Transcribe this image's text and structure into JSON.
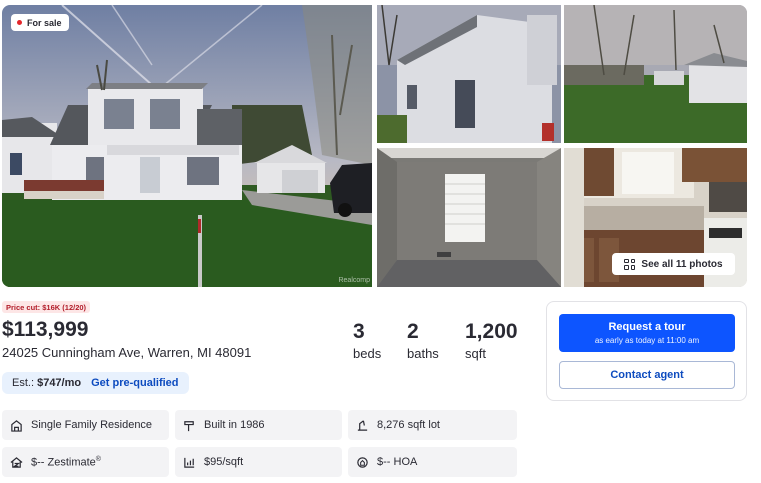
{
  "gallery": {
    "status_badge": "For sale",
    "see_all_label": "See all 11 photos",
    "watermark": "Realcomp",
    "status_color": "#e4262b"
  },
  "listing": {
    "price_cut": "Price cut: $16K (12/20)",
    "price": "$113,999",
    "address": "24025 Cunningham Ave, Warren, MI 48091",
    "beds": {
      "value": "3",
      "label": "beds"
    },
    "baths": {
      "value": "2",
      "label": "baths"
    },
    "sqft": {
      "value": "1,200",
      "label": "sqft"
    },
    "estimate": {
      "prefix": "Est.:",
      "amount": "$747/mo",
      "link": "Get pre-qualified"
    }
  },
  "features": {
    "type": {
      "label": "Single Family Residence",
      "icon": "house-icon"
    },
    "built": {
      "label": "Built in 1986",
      "icon": "hammer-icon"
    },
    "lot": {
      "label": "8,276 sqft lot",
      "icon": "ruler-icon"
    },
    "zestimate": {
      "label": "$-- Zestimate",
      "sup": "®",
      "icon": "zestimate-icon"
    },
    "price_per_sqft": {
      "label": "$95/sqft",
      "icon": "price-chart-icon"
    },
    "hoa": {
      "label": "$-- HOA",
      "icon": "hoa-icon"
    }
  },
  "actions": {
    "tour_title": "Request a tour",
    "tour_subtitle": "as early as today at 11:00 am",
    "contact_label": "Contact agent",
    "accent_color": "#0d55ff"
  }
}
